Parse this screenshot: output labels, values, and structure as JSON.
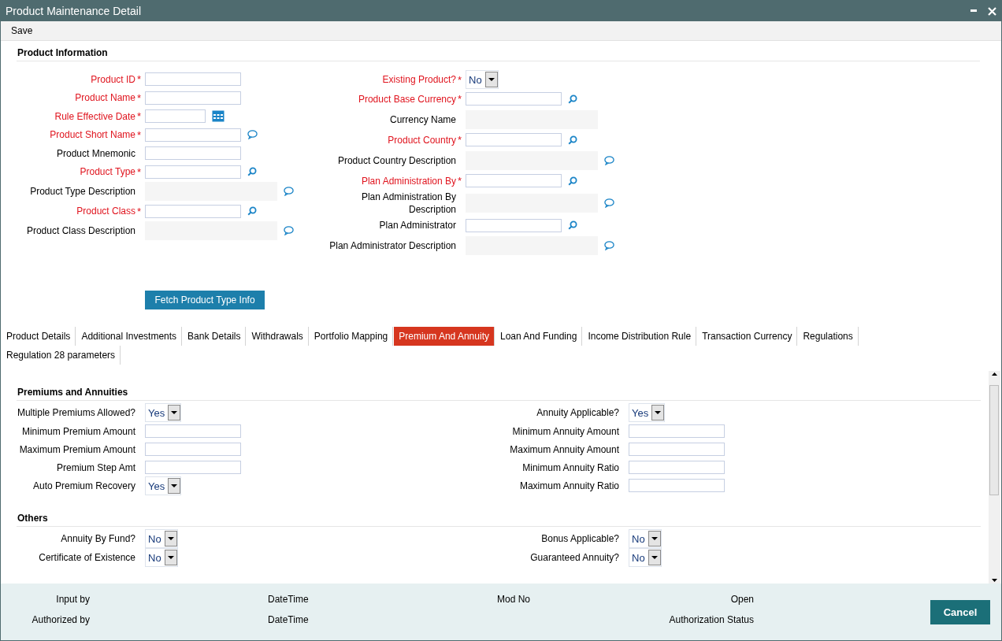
{
  "window": {
    "title": "Product Maintenance Detail"
  },
  "toolbar": {
    "buttons": [
      "Save"
    ]
  },
  "product_information": {
    "title": "Product Information",
    "left_fields": [
      {
        "label": "Product ID",
        "required": true,
        "marker": "*",
        "kind": "input"
      },
      {
        "label": "Product Name",
        "required": true,
        "marker": "*",
        "kind": "input"
      },
      {
        "label": "Rule Effective Date",
        "required": true,
        "marker": "*",
        "kind": "date"
      },
      {
        "label": "Product Short Name",
        "required": true,
        "marker": "*",
        "kind": "popup"
      },
      {
        "label": "Product Mnemonic",
        "required": false,
        "kind": "input"
      },
      {
        "label": "Product Type",
        "required": true,
        "marker": "*",
        "kind": "search"
      },
      {
        "label": "Product Type Description",
        "required": false,
        "kind": "readonly-popup"
      },
      {
        "label": "Product Class",
        "required": true,
        "marker": "*",
        "kind": "search"
      },
      {
        "label": "Product Class Description",
        "required": false,
        "kind": "readonly-popup"
      }
    ],
    "right_fields": [
      {
        "label": "Existing Product?",
        "required": true,
        "marker": "*",
        "kind": "select",
        "value": "No"
      },
      {
        "label": "Product Base Currency",
        "required": true,
        "marker": "*",
        "kind": "search"
      },
      {
        "label": "Currency Name",
        "required": false,
        "kind": "readonly"
      },
      {
        "label": "Product Country",
        "required": true,
        "marker": "*",
        "kind": "search"
      },
      {
        "label": "Product Country Description",
        "required": false,
        "kind": "readonly-popup"
      },
      {
        "label": "Plan Administration By",
        "required": true,
        "marker": "*",
        "kind": "search"
      },
      {
        "label": "Plan Administration By Description",
        "required": false,
        "kind": "readonly-popup"
      },
      {
        "label": "Plan Administrator",
        "required": false,
        "kind": "search"
      },
      {
        "label": "Plan Administrator Description",
        "required": false,
        "kind": "readonly-popup"
      }
    ],
    "action_button": "Fetch Product Type Info"
  },
  "tabs": [
    {
      "label": "Product Details",
      "selected": false
    },
    {
      "label": "Additional Investments",
      "selected": false
    },
    {
      "label": "Bank Details",
      "selected": false
    },
    {
      "label": "Withdrawals",
      "selected": false
    },
    {
      "label": "Portfolio Mapping",
      "selected": false
    },
    {
      "label": "Premium And Annuity",
      "selected": true
    },
    {
      "label": "Loan And Funding",
      "selected": false
    },
    {
      "label": "Income Distribution Rule",
      "selected": false
    },
    {
      "label": "Transaction Currency",
      "selected": false
    },
    {
      "label": "Regulations",
      "selected": false
    },
    {
      "label": "Regulation 28 parameters",
      "selected": false
    }
  ],
  "sections": [
    {
      "title": "Premiums and Annuities",
      "left_fields": [
        {
          "label": "Multiple Premiums Allowed?",
          "kind": "select",
          "value": "Yes"
        },
        {
          "label": "Minimum Premium Amount",
          "kind": "input"
        },
        {
          "label": "Maximum Premium Amount",
          "kind": "input"
        },
        {
          "label": "Premium Step Amt",
          "kind": "input"
        },
        {
          "label": "Auto Premium Recovery",
          "kind": "select",
          "value": "Yes"
        }
      ],
      "right_fields": [
        {
          "label": "Annuity Applicable?",
          "kind": "select",
          "value": "Yes"
        },
        {
          "label": "Minimum Annuity Amount",
          "kind": "input"
        },
        {
          "label": "Maximum Annuity Amount",
          "kind": "input"
        },
        {
          "label": "Minimum Annuity Ratio",
          "kind": "input"
        },
        {
          "label": "Maximum Annuity Ratio",
          "kind": "input"
        }
      ]
    },
    {
      "title": "Others",
      "left_fields": [
        {
          "label": "Annuity By Fund?",
          "kind": "select",
          "value": "No"
        },
        {
          "label": "Certificate of Existence",
          "kind": "select",
          "value": "No"
        }
      ],
      "right_fields": [
        {
          "label": "Bonus Applicable?",
          "kind": "select",
          "value": "No"
        },
        {
          "label": "Guaranteed Annuity?",
          "kind": "select",
          "value": "No"
        }
      ]
    }
  ],
  "footer": {
    "rows": [
      {
        "user_label": "Input by",
        "time_label": "DateTime",
        "mod_label": "Mod No",
        "status_label": "Open"
      },
      {
        "user_label": "Authorized by",
        "time_label": "DateTime",
        "status_label": "Authorization Status"
      }
    ],
    "cancel_button": "Cancel"
  }
}
